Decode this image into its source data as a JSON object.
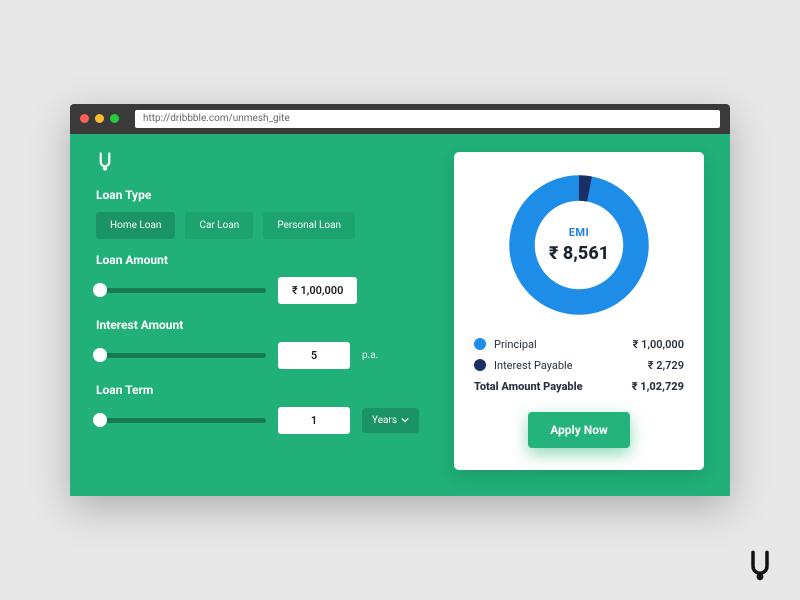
{
  "browser": {
    "url": "http://dribbble.com/unmesh_gite"
  },
  "form": {
    "loan_type_label": "Loan Type",
    "tabs": [
      "Home Loan",
      "Car Loan",
      "Personal Loan"
    ],
    "loan_amount_label": "Loan Amount",
    "loan_amount_value": "₹ 1,00,000",
    "interest_label": "Interest Amount",
    "interest_value": "5",
    "interest_suffix": "p.a.",
    "term_label": "Loan Term",
    "term_value": "1",
    "term_unit": "Years"
  },
  "result": {
    "emi_label": "EMI",
    "emi_value": "₹ 8,561",
    "principal_label": "Principal",
    "principal_value": "₹ 1,00,000",
    "interest_payable_label": "Interest Payable",
    "interest_payable_value": "₹ 2,729",
    "total_label": "Total Amount Payable",
    "total_value": "₹ 1,02,729",
    "apply_label": "Apply Now"
  },
  "chart_data": {
    "type": "pie",
    "title": "EMI",
    "series": [
      {
        "name": "Principal",
        "value": 100000,
        "color": "#1e8de8"
      },
      {
        "name": "Interest Payable",
        "value": 2729,
        "color": "#1b2e66"
      }
    ]
  }
}
